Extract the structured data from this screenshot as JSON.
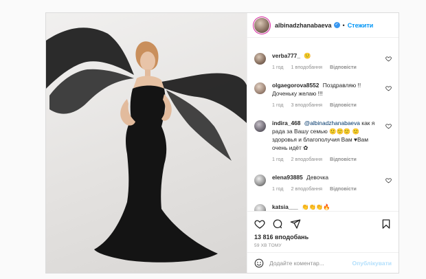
{
  "post": {
    "author": "albinadzhanabaeva",
    "follow_label": "Стежити",
    "likes": "13 816 вподобань",
    "time_ago": "59 ХВ ТОМУ",
    "add_comment_placeholder": "Додайте коментар...",
    "publish_label": "Опублікувати"
  },
  "comments": [
    {
      "author": "verba777_",
      "text": "🙂",
      "time": "1 год",
      "likes": "1 вподобання",
      "reply": "Відповісти"
    },
    {
      "author": "olgaegorova8552",
      "text": "Поздравляю !! Доченьку желаю !!!",
      "time": "1 год",
      "likes": "3 вподобання",
      "reply": "Відповісти"
    },
    {
      "author": "indira_468",
      "mention": "@albinadzhanabaeva",
      "text": "как я рада за Вашу семью 🙂🙂🙂 🙂здоровья и благополучия Вам ♥Вам очень идёт ✿",
      "time": "1 год",
      "likes": "2 вподобання",
      "reply": "Відповісти"
    },
    {
      "author": "elena93885",
      "text": "Девочка",
      "time": "1 год",
      "likes": "2 вподобання",
      "reply": "Відповісти"
    },
    {
      "author": "katsia___",
      "text": "👏👏👏🔥"
    }
  ],
  "icons": [
    "heart-icon",
    "comment-icon",
    "share-icon",
    "bookmark-icon",
    "emoji-icon"
  ]
}
